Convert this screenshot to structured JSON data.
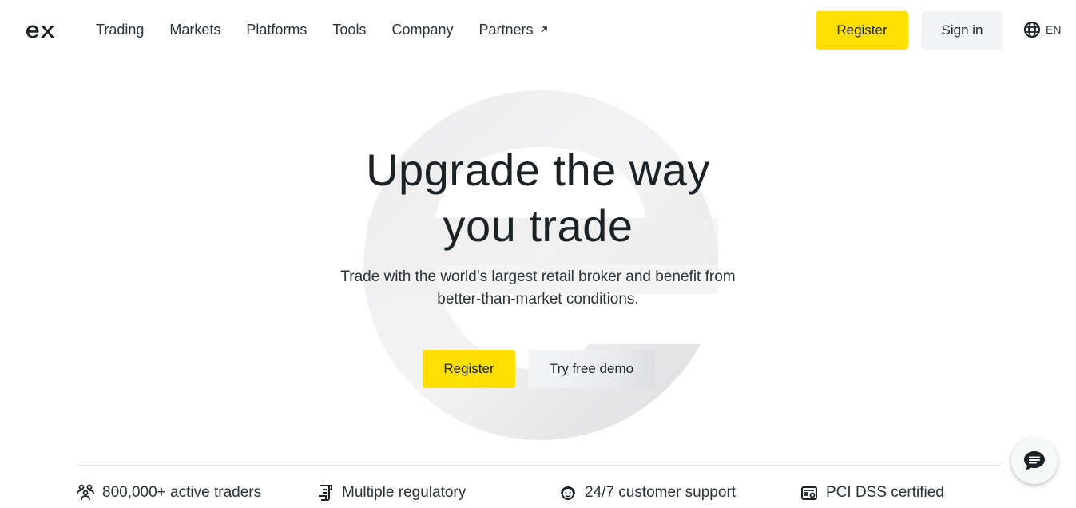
{
  "header": {
    "logo_text": "ex",
    "nav": [
      {
        "label": "Trading",
        "external": false
      },
      {
        "label": "Markets",
        "external": false
      },
      {
        "label": "Platforms",
        "external": false
      },
      {
        "label": "Tools",
        "external": false
      },
      {
        "label": "Company",
        "external": false
      },
      {
        "label": "Partners",
        "external": true,
        "icon": "arrow-up-right-icon"
      }
    ],
    "register_label": "Register",
    "signin_label": "Sign in",
    "language": {
      "icon": "globe-icon",
      "code": "EN"
    }
  },
  "hero": {
    "title_line1": "Upgrade the way",
    "title_line2": "you trade",
    "subtitle_line1": "Trade with the world’s largest retail broker and benefit from",
    "subtitle_line2": "better-than-market conditions.",
    "register_label": "Register",
    "demo_label": "Try free demo"
  },
  "features": [
    {
      "icon": "users-icon",
      "label": "800,000+ active traders"
    },
    {
      "icon": "regulation-document-icon",
      "label": "Multiple regulatory"
    },
    {
      "icon": "support-smile-icon",
      "label": "24/7 customer support"
    },
    {
      "icon": "certificate-icon",
      "label": "PCI DSS certified"
    }
  ],
  "chat": {
    "icon": "chat-bubble-icon"
  },
  "colors": {
    "accent_yellow": "#ffde02",
    "text_dark": "#1b2226",
    "button_grey": "#f3f4f5"
  }
}
